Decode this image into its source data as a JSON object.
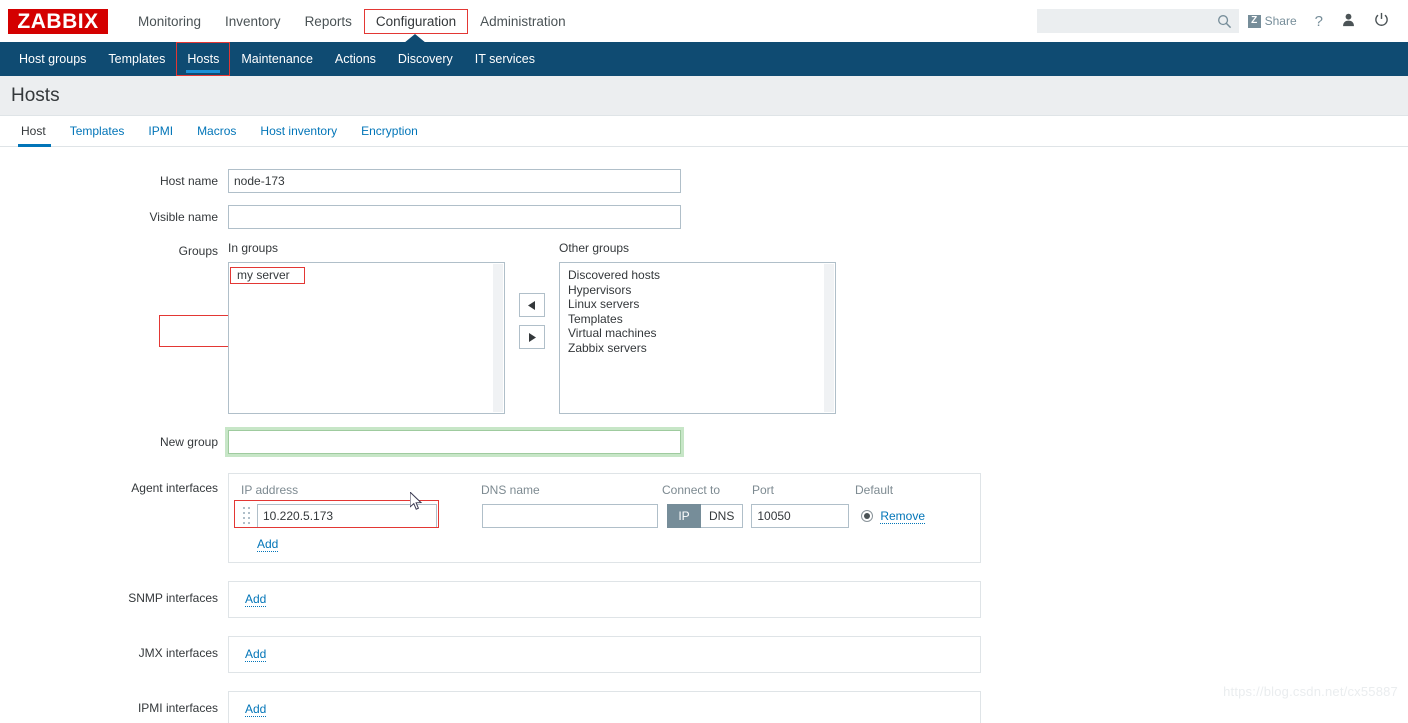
{
  "app": {
    "logo": "ZABBIX",
    "watermark": "https://blog.csdn.net/cx55887"
  },
  "topnav": {
    "items": [
      {
        "label": "Monitoring",
        "selected": false
      },
      {
        "label": "Inventory",
        "selected": false
      },
      {
        "label": "Reports",
        "selected": false
      },
      {
        "label": "Configuration",
        "selected": true
      },
      {
        "label": "Administration",
        "selected": false
      }
    ],
    "search": {
      "value": "",
      "placeholder": ""
    },
    "share_label": "Share",
    "share_badge": "Z",
    "help_label": "?",
    "user_icon": "user-icon",
    "signout_icon": "power-icon"
  },
  "subnav": {
    "items": [
      {
        "label": "Host groups",
        "selected": false
      },
      {
        "label": "Templates",
        "selected": false
      },
      {
        "label": "Hosts",
        "selected": true
      },
      {
        "label": "Maintenance",
        "selected": false
      },
      {
        "label": "Actions",
        "selected": false
      },
      {
        "label": "Discovery",
        "selected": false
      },
      {
        "label": "IT services",
        "selected": false
      }
    ]
  },
  "page": {
    "title": "Hosts"
  },
  "tabs": [
    {
      "label": "Host",
      "active": true
    },
    {
      "label": "Templates",
      "active": false
    },
    {
      "label": "IPMI",
      "active": false
    },
    {
      "label": "Macros",
      "active": false
    },
    {
      "label": "Host inventory",
      "active": false
    },
    {
      "label": "Encryption",
      "active": false
    }
  ],
  "form": {
    "host_name": {
      "label": "Host name",
      "value": "node-173"
    },
    "visible_name": {
      "label": "Visible name",
      "value": ""
    },
    "groups": {
      "label": "Groups",
      "in_groups_caption": "In groups",
      "other_groups_caption": "Other groups",
      "in_groups": [
        "my server"
      ],
      "other_groups": [
        "Discovered hosts",
        "Hypervisors",
        "Linux servers",
        "Templates",
        "Virtual machines",
        "Zabbix servers"
      ],
      "move_left_icon": "arrow-left-icon",
      "move_right_icon": "arrow-right-icon"
    },
    "new_group": {
      "label": "New group",
      "value": "",
      "placeholder": ""
    },
    "agent_interfaces": {
      "label": "Agent interfaces",
      "headers": {
        "ip": "IP address",
        "dns": "DNS name",
        "connect_to": "Connect to",
        "port": "Port",
        "default": "Default"
      },
      "rows": [
        {
          "ip": "10.220.5.173",
          "dns": "",
          "connect_to": "IP",
          "connect_options": [
            "IP",
            "DNS"
          ],
          "port": "10050",
          "default_selected": true,
          "remove_label": "Remove"
        }
      ],
      "add_label": "Add"
    },
    "snmp_interfaces": {
      "label": "SNMP interfaces",
      "add_label": "Add"
    },
    "jmx_interfaces": {
      "label": "JMX interfaces",
      "add_label": "Add"
    },
    "ipmi_interfaces": {
      "label": "IPMI interfaces",
      "add_label": "Add"
    }
  },
  "colors": {
    "brand_red": "#d40000",
    "nav_blue": "#0f4b72",
    "link_blue": "#0275b8",
    "annotation_red": "#e33734",
    "toggle_on": "#768d99",
    "focus_green": "#c7e6c7"
  }
}
